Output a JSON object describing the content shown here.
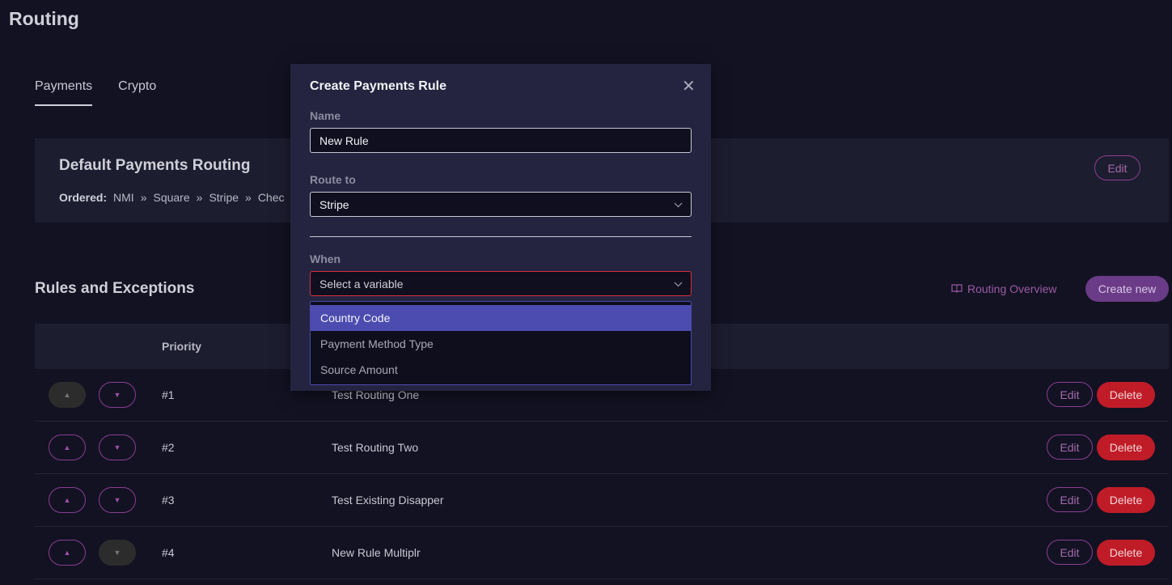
{
  "page": {
    "title": "Routing"
  },
  "tabs": [
    {
      "label": "Payments",
      "active": true
    },
    {
      "label": "Crypto",
      "active": false
    }
  ],
  "default_routing": {
    "title": "Default Payments Routing",
    "ordered_label": "Ordered:",
    "providers": [
      "NMI",
      "Square",
      "Stripe",
      "Chec"
    ],
    "separator": "»",
    "edit_label": "Edit"
  },
  "rules": {
    "title": "Rules and Exceptions",
    "overview_label": "Routing Overview",
    "create_label": "Create new",
    "columns": {
      "priority": "Priority"
    },
    "rows": [
      {
        "priority": "#1",
        "name": "Test Routing One",
        "edit": "Edit",
        "delete": "Delete",
        "up_disabled": true,
        "down_disabled": false
      },
      {
        "priority": "#2",
        "name": "Test Routing Two",
        "edit": "Edit",
        "delete": "Delete",
        "up_disabled": false,
        "down_disabled": false
      },
      {
        "priority": "#3",
        "name": "Test Existing Disapper",
        "edit": "Edit",
        "delete": "Delete",
        "up_disabled": false,
        "down_disabled": false
      },
      {
        "priority": "#4",
        "name": "New Rule Multiplr",
        "edit": "Edit",
        "delete": "Delete",
        "up_disabled": false,
        "down_disabled": true
      }
    ]
  },
  "modal": {
    "title": "Create Payments Rule",
    "name_label": "Name",
    "name_value": "New Rule",
    "route_label": "Route to",
    "route_value": "Stripe",
    "when_label": "When",
    "when_placeholder": "Select a variable",
    "options": [
      "Country Code",
      "Payment Method Type",
      "Source Amount"
    ],
    "selected_option": "Country Code"
  },
  "colors": {
    "background": "#121223",
    "accent": "#8a3f8f",
    "danger": "#c01c28",
    "highlight": "#4c4cb0"
  }
}
